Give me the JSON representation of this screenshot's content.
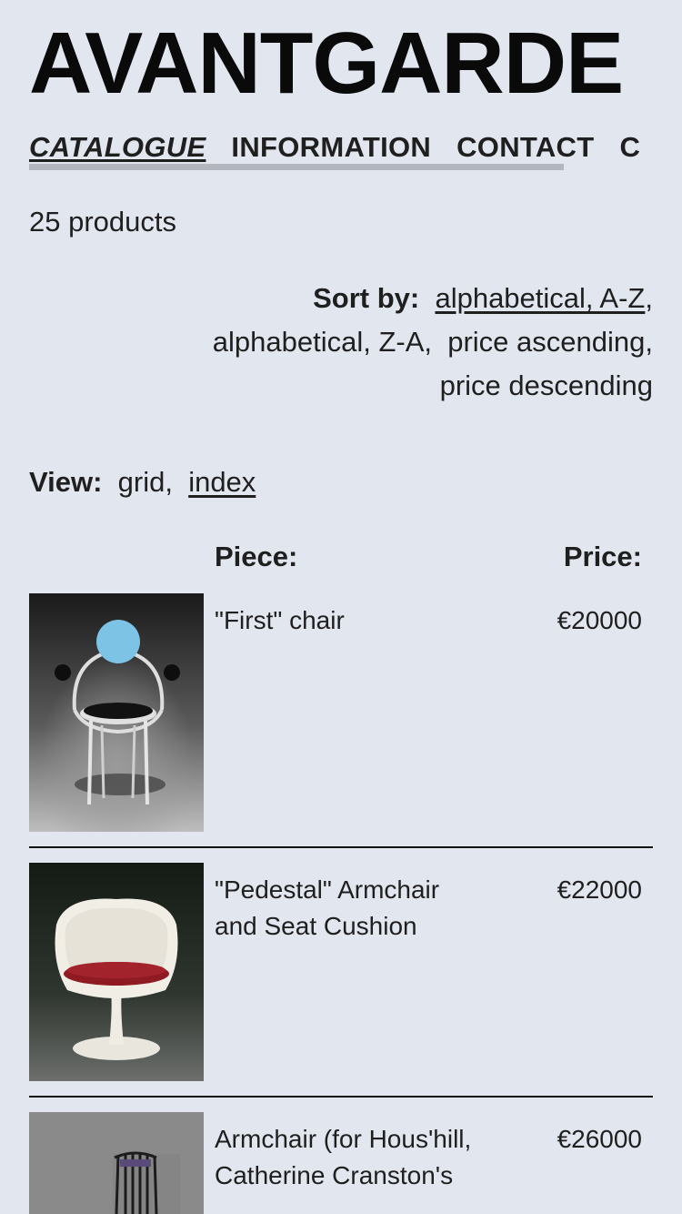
{
  "header": {
    "brand": "AVANTGARDE"
  },
  "nav": {
    "items": [
      {
        "label": "CATALOGUE",
        "active": true
      },
      {
        "label": "INFORMATION",
        "active": false
      },
      {
        "label": "CONTACT",
        "active": false
      },
      {
        "label": "C",
        "active": false
      }
    ]
  },
  "catalogue": {
    "count_text": "25 products",
    "sort": {
      "label": "Sort by:",
      "options": [
        {
          "label": "alphabetical, A-Z",
          "active": true
        },
        {
          "label": "alphabetical, Z-A",
          "active": false
        },
        {
          "label": "price ascending",
          "active": false
        },
        {
          "label": "price descending",
          "active": false
        }
      ]
    },
    "view": {
      "label": "View:",
      "options": [
        {
          "label": "grid",
          "active": false
        },
        {
          "label": "index",
          "active": true
        }
      ]
    },
    "columns": {
      "piece": "Piece:",
      "price": "Price:"
    },
    "products": [
      {
        "name": "\"First\" chair",
        "price": "€20000",
        "image": "first-chair-image"
      },
      {
        "name": "\"Pedestal\" Armchair and Seat Cushion",
        "price": "€22000",
        "image": "pedestal-armchair-image"
      },
      {
        "name": "Armchair (for Hous'hill, Catherine Cranston's",
        "price": "€26000",
        "image": "hous-hill-armchair-image"
      }
    ]
  },
  "colors": {
    "background": "#e1e6ef",
    "text": "#1f1f1f",
    "scrollbar": "#b4b6bd",
    "divider": "#111111"
  }
}
